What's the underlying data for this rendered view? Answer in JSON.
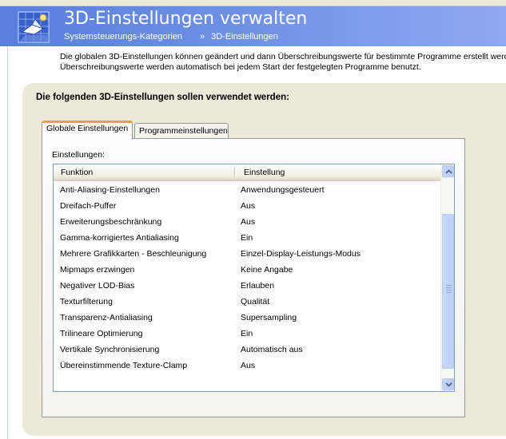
{
  "header": {
    "title": "3D-Einstellungen verwalten",
    "breadcrumb_root": "Systemsteuerungs-Kategorien",
    "breadcrumb_separator": "»",
    "breadcrumb_current": "3D-Einstellungen",
    "icon": "3d-cube-icon"
  },
  "description": {
    "line1": "Die globalen 3D-Einstellungen können geändert und dann Überschreibungswerte für bestimmte Programme erstellt werd",
    "line2": "Überschreibungswerte werden automatisch bei jedem Start der festgelegten Programme benutzt."
  },
  "panel": {
    "heading": "Die folgenden 3D-Einstellungen sollen verwendet werden:",
    "tabs": [
      {
        "label": "Globale Einstellungen",
        "active": true
      },
      {
        "label": "Programmeinstellungen",
        "active": false
      }
    ],
    "settings_label": "Einstellungen:"
  },
  "table": {
    "columns": [
      "Funktion",
      "Einstellung"
    ],
    "rows": [
      [
        "Anti-Aliasing-Einstellungen",
        "Anwendungsgesteuert"
      ],
      [
        "Dreifach-Puffer",
        "Aus"
      ],
      [
        "Erweiterungsbeschränkung",
        "Aus"
      ],
      [
        "Gamma-korrigiertes Antialiasing",
        "Ein"
      ],
      [
        "Mehrere Grafikkarten - Beschleunigung",
        "Einzel-Display-Leistungs-Modus"
      ],
      [
        "Mipmaps erzwingen",
        "Keine Angabe"
      ],
      [
        "Negativer LOD-Bias",
        "Erlauben"
      ],
      [
        "Texturfilterung",
        "Qualität"
      ],
      [
        "Transparenz-Antialiasing",
        "Supersampling"
      ],
      [
        "Trilineare Optimierung",
        "Ein"
      ],
      [
        "Vertikale Synchronisierung",
        "Automatisch aus"
      ],
      [
        "Übereinstimmende Texture-Clamp",
        "Aus"
      ]
    ]
  },
  "colors": {
    "header_gradient_start": "#5a7edc",
    "header_gradient_end": "#8eaaf0",
    "panel_background": "#ece9d8",
    "active_tab_accent": "#e6a13a",
    "list_border": "#7f9db9",
    "scrollbar_thumb": "#bccff8"
  }
}
